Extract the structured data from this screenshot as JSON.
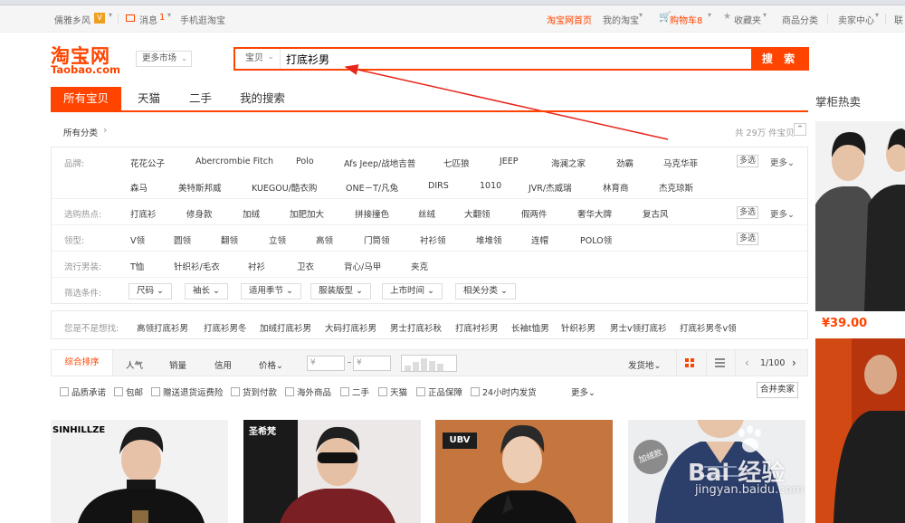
{
  "top_nav": {
    "user": "儒雅乡风",
    "messages": "消息",
    "messages_count": "1",
    "mobile": "手机逛淘宝",
    "home": "淘宝网首页",
    "my_taobao": "我的淘宝",
    "cart": "购物车8",
    "favorites": "收藏夹",
    "categories": "商品分类",
    "seller_center": "卖家中心",
    "contact": "联"
  },
  "header": {
    "logo_cn": "淘宝网",
    "logo_en": "Taobao.com",
    "more_market": "更多市场"
  },
  "search": {
    "scope": "宝贝",
    "query": "打底衫男",
    "button": "搜 索"
  },
  "tabs": [
    "所有宝贝",
    "天猫",
    "二手",
    "我的搜索"
  ],
  "right_column": {
    "title": "掌柜热卖",
    "price": "¥39.00"
  },
  "breadcrumb": {
    "all_categories": "所有分类",
    "result_count": "共 29万 件宝贝"
  },
  "filters": {
    "brand": {
      "label": "品牌:",
      "row1": [
        "花花公子",
        "Abercrombie Fitch",
        "Polo",
        "Afs Jeep/战地吉普",
        "七匹狼",
        "JEEP",
        "海澜之家",
        "劲霸",
        "马克华菲"
      ],
      "row2": [
        "森马",
        "美特斯邦威",
        "KUEGOU/酷衣购",
        "ONE－T/凡兔",
        "DIRS",
        "1010",
        "JVR/杰威瑞",
        "林育商",
        "杰克琼斯"
      ]
    },
    "hot": {
      "label": "选购热点:",
      "items": [
        "打底衫",
        "修身款",
        "加绒",
        "加肥加大",
        "拼接撞色",
        "丝绒",
        "大翻领",
        "假两件",
        "奢华大牌",
        "复古风"
      ]
    },
    "collar": {
      "label": "领型:",
      "items": [
        "V领",
        "圆领",
        "翻领",
        "立领",
        "高领",
        "门筒领",
        "衬衫领",
        "堆堆领",
        "连帽",
        "POLO领"
      ]
    },
    "popular": {
      "label": "流行男装:",
      "items": [
        "T恤",
        "针织衫/毛衣",
        "衬衫",
        "卫衣",
        "背心/马甲",
        "夹克"
      ]
    },
    "conditions": {
      "label": "筛选条件:",
      "items": [
        "尺码",
        "袖长",
        "适用季节",
        "服装版型",
        "上市时间",
        "相关分类"
      ]
    },
    "multi": "多选",
    "more": "更多"
  },
  "suggest": {
    "label": "您是不是想找:",
    "items": [
      "高领打底衫男",
      "打底衫男冬",
      "加绒打底衫男",
      "大码打底衫男",
      "男士打底衫秋",
      "打底衬衫男",
      "长袖t恤男",
      "针织衫男",
      "男士v领打底衫",
      "打底衫男冬v领"
    ]
  },
  "sortbar": {
    "items": [
      "综合排序",
      "人气",
      "销量",
      "信用",
      "价格"
    ],
    "price_from": "¥",
    "price_to": "¥",
    "ship_from": "发货地",
    "page": "1/100"
  },
  "checks": [
    "品质承诺",
    "包邮",
    "赠送退货运费险",
    "货到付款",
    "海外商品",
    "二手",
    "天猫",
    "正品保障",
    "24小时内发货"
  ],
  "checks_more": "更多",
  "merge_seller": "合并卖家",
  "products": [
    {
      "brand": "SINHILLZE"
    },
    {
      "brand": "圣希梵"
    },
    {
      "brand": "UBV"
    },
    {
      "brand": "加绒款"
    }
  ],
  "watermark": {
    "brand": "Bai 经验",
    "url": "jingyan.baidu.com"
  },
  "colors": {
    "accent": "#ff4400",
    "nav_bg": "#f5f5f5"
  }
}
